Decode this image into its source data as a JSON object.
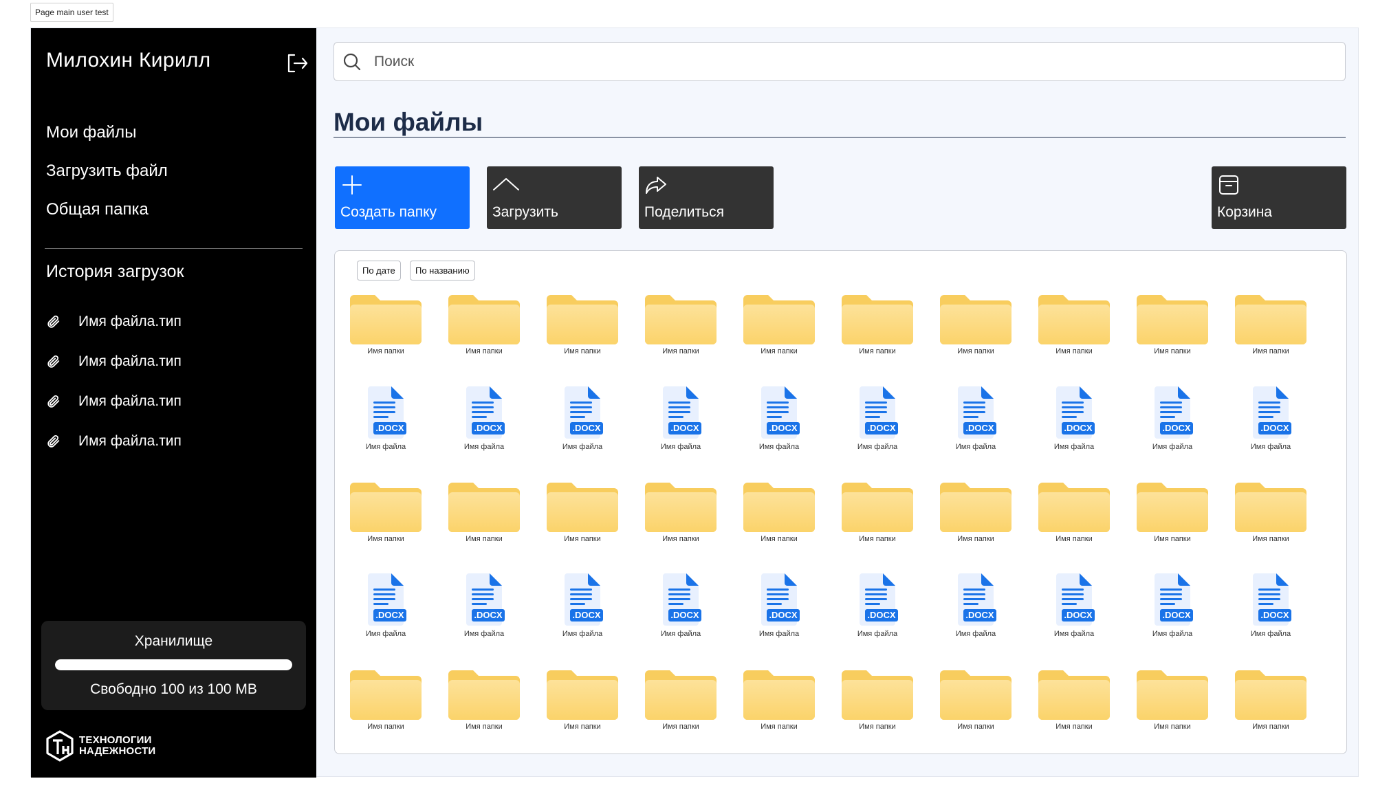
{
  "frame_label": "Page main user test",
  "sidebar": {
    "user_name": "Милохин Кирилл",
    "nav": [
      "Мои файлы",
      "Загрузить файл",
      "Общая папка"
    ],
    "history_title": "История загрузок",
    "history": [
      "Имя файла.тип",
      "Имя файла.тип",
      "Имя файла.тип",
      "Имя файла.тип"
    ],
    "storage": {
      "title": "Хранилище",
      "free_text": "Свободно 100 из 100 MB",
      "free_fraction": 1.0
    },
    "brand": [
      "ТЕХНОЛОГИИ",
      "НАДЕЖНОСТИ"
    ]
  },
  "search": {
    "placeholder": "Поиск"
  },
  "page_title": "Мои файлы",
  "actions": {
    "create": "Создать папку",
    "upload": "Загрузить",
    "share": "Поделиться",
    "trash": "Корзина"
  },
  "sort": {
    "by_date": "По дате",
    "by_name": "По названию"
  },
  "grid": {
    "rows": [
      "folder",
      "file",
      "folder",
      "file",
      "folder"
    ],
    "columns": 10,
    "folder_label": "Имя папки",
    "file_label": "Имя файла",
    "file_badge": ".DOCX"
  },
  "colors": {
    "accent": "#1070ff",
    "folder": "#fcd872",
    "doc_blue": "#1a73e8"
  }
}
